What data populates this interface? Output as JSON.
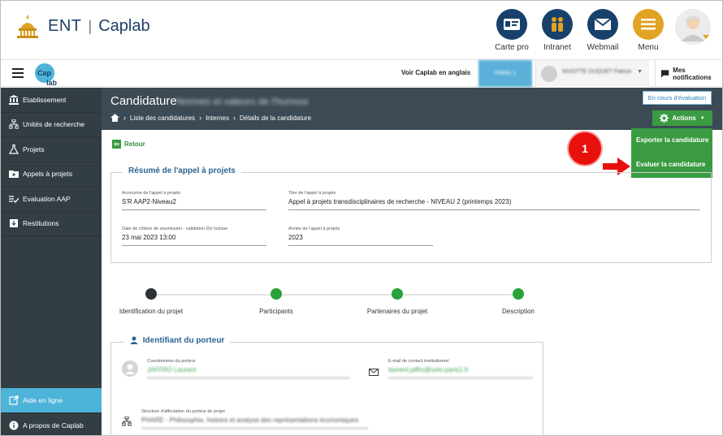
{
  "header": {
    "ent_label": "ENT",
    "separator": "|",
    "app_name": "Caplab",
    "icons": [
      {
        "label": "Carte pro",
        "icon": "id-card-icon",
        "color": "#17416b"
      },
      {
        "label": "Intranet",
        "icon": "people-icon",
        "color": "#17416b"
      },
      {
        "label": "Webmail",
        "icon": "envelope-icon",
        "color": "#17416b"
      },
      {
        "label": "Menu",
        "icon": "hamburger-icon",
        "color": "#e0a324"
      }
    ]
  },
  "navbar": {
    "logo_top": "Cap",
    "logo_bottom": "lab",
    "voir_link": "Voir Caplab en anglais",
    "blue_tab": "PARIS 1",
    "user_name": "NIVOTTE DUQUET Patrice",
    "notifications": "Mes notifications"
  },
  "sidebar": {
    "items": [
      {
        "label": "Etablissement",
        "icon": "bank-icon"
      },
      {
        "label": "Unités de recherche",
        "icon": "network-icon"
      },
      {
        "label": "Projets",
        "icon": "flask-icon"
      },
      {
        "label": "Appels à projets",
        "icon": "folder-icon"
      },
      {
        "label": "Evaluation AAP",
        "icon": "check-list-icon"
      },
      {
        "label": "Restitutions",
        "icon": "download-icon"
      }
    ],
    "help": "Aide en ligne",
    "about": "A propos de Caplab"
  },
  "title_band": {
    "title": "Candidature",
    "title_blurred": "Normes et valeurs de l'humour",
    "breadcrumbs": [
      "Liste des candidatures",
      "Internes",
      "Détails de la candidature"
    ],
    "status": "En cours d'évaluation",
    "actions_label": "Actions"
  },
  "dropdown": {
    "items": [
      "Exporter la candidature",
      "Evaluer la candidature"
    ]
  },
  "marker": "1",
  "back_label": "Retour",
  "resume": {
    "legend": "Résumé de l'appel à projets",
    "acronyme_label": "Acronyme de l'appel à projets",
    "acronyme_value": "S'R AAP2-Niveau2",
    "titre_label": "Titre de l'appel à projets",
    "titre_value": "Appel à projets transdisciplinaires de recherche - NIVEAU 2 (printemps 2023)",
    "date_label": "Date de clôture de soumission - validation DU incluse",
    "date_value": "23 mai 2023 13:00",
    "annee_label": "Année de l'appel à projets",
    "annee_value": "2023"
  },
  "steps": [
    "Identification du projet",
    "Participants",
    "Partenaires du projet",
    "Description"
  ],
  "porteur": {
    "legend": "Identifiant du porteur",
    "coord_label": "Coordonnées du porteur",
    "coord_value": "JAFFRO Laurent",
    "email_label": "E-mail de contact institutionnel",
    "email_value": "laurent.jaffro@univ-paris1.fr",
    "structure_label": "Structure d'affectation du porteur de projet",
    "structure_value": "PHARE - Philosophie, histoire et analyse des représentations économiques"
  },
  "colors": {
    "sidebar": "#333e44",
    "title_band": "#3b4a55",
    "accent_green": "#3a9b42",
    "accent_blue": "#4db3d9",
    "marker_red": "#e8100c"
  }
}
